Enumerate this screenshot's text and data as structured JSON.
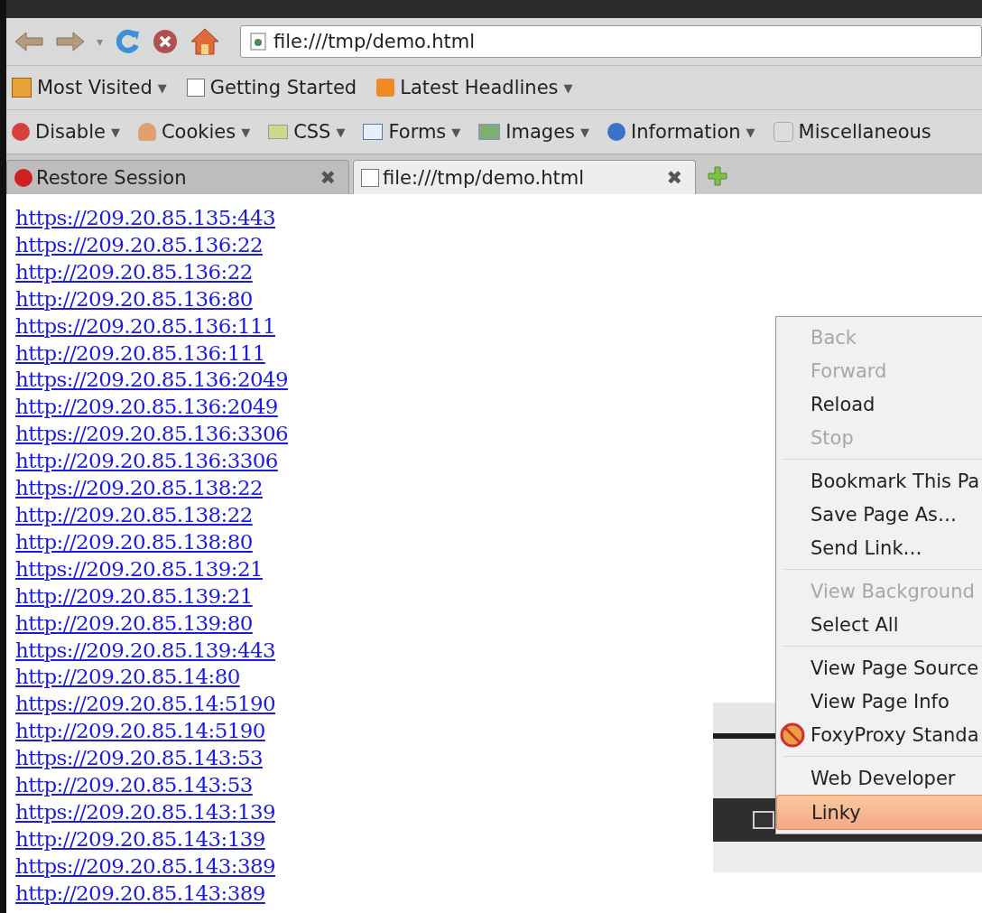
{
  "nav_toolbar": {
    "history_dropdown": "▾",
    "url": "file:///tmp/demo.html"
  },
  "bookmarks_bar": [
    {
      "kind": "folder",
      "label": "Most Visited",
      "dropdown": "▼"
    },
    {
      "kind": "page",
      "label": "Getting Started"
    },
    {
      "kind": "feed",
      "label": "Latest Headlines",
      "dropdown": "▼"
    }
  ],
  "web_developer_toolbar": [
    {
      "kind": "disable",
      "label": "Disable",
      "dropdown": "▼"
    },
    {
      "kind": "cookies",
      "label": "Cookies",
      "dropdown": "▼"
    },
    {
      "kind": "css",
      "label": "CSS",
      "dropdown": "▼"
    },
    {
      "kind": "forms",
      "label": "Forms",
      "dropdown": "▼"
    },
    {
      "kind": "images",
      "label": "Images",
      "dropdown": "▼"
    },
    {
      "kind": "information",
      "label": "Information",
      "dropdown": "▼"
    },
    {
      "kind": "misc",
      "label": "Miscellaneous"
    }
  ],
  "tabs": [
    {
      "kind": "warning",
      "label": "Restore Session",
      "close": "✖",
      "selected": false
    },
    {
      "kind": "page",
      "label": "file:///tmp/demo.html",
      "close": "✖",
      "selected": true
    }
  ],
  "links": [
    "https://209.20.85.135:443",
    "https://209.20.85.136:22",
    "http://209.20.85.136:22",
    "http://209.20.85.136:80",
    "https://209.20.85.136:111",
    "http://209.20.85.136:111",
    "https://209.20.85.136:2049",
    "http://209.20.85.136:2049",
    "https://209.20.85.136:3306",
    "http://209.20.85.136:3306",
    "https://209.20.85.138:22",
    "http://209.20.85.138:22",
    "http://209.20.85.138:80",
    "https://209.20.85.139:21",
    "http://209.20.85.139:21",
    "http://209.20.85.139:80",
    "https://209.20.85.139:443",
    "http://209.20.85.14:80",
    "https://209.20.85.14:5190",
    "http://209.20.85.14:5190",
    "https://209.20.85.143:53",
    "http://209.20.85.143:53",
    "https://209.20.85.143:139",
    "http://209.20.85.143:139",
    "https://209.20.85.143:389",
    "http://209.20.85.143:389"
  ],
  "context_menu": [
    {
      "kind": "item",
      "label": "Back",
      "disabled": true,
      "selected": false
    },
    {
      "kind": "item",
      "label": "Forward",
      "disabled": true,
      "selected": false
    },
    {
      "kind": "item",
      "label": "Reload",
      "disabled": false,
      "selected": false
    },
    {
      "kind": "item",
      "label": "Stop",
      "disabled": true,
      "selected": false
    },
    {
      "kind": "separator"
    },
    {
      "kind": "item",
      "label": "Bookmark This Pa",
      "disabled": false,
      "selected": false
    },
    {
      "kind": "item",
      "label": "Save Page As…",
      "disabled": false,
      "selected": false
    },
    {
      "kind": "item",
      "label": "Send Link…",
      "disabled": false,
      "selected": false
    },
    {
      "kind": "separator"
    },
    {
      "kind": "item",
      "label": "View Background",
      "disabled": true,
      "selected": false
    },
    {
      "kind": "item",
      "label": "Select All",
      "disabled": false,
      "selected": false
    },
    {
      "kind": "separator"
    },
    {
      "kind": "item",
      "label": "View Page Source",
      "disabled": false,
      "selected": false
    },
    {
      "kind": "item",
      "label": "View Page Info",
      "disabled": false,
      "selected": false
    },
    {
      "kind": "proxy",
      "label": "FoxyProxy Standa",
      "disabled": false,
      "selected": false
    },
    {
      "kind": "separator"
    },
    {
      "kind": "item",
      "label": "Web Developer",
      "disabled": false,
      "selected": false
    },
    {
      "kind": "item",
      "label": "Linky",
      "disabled": false,
      "selected": true
    }
  ]
}
